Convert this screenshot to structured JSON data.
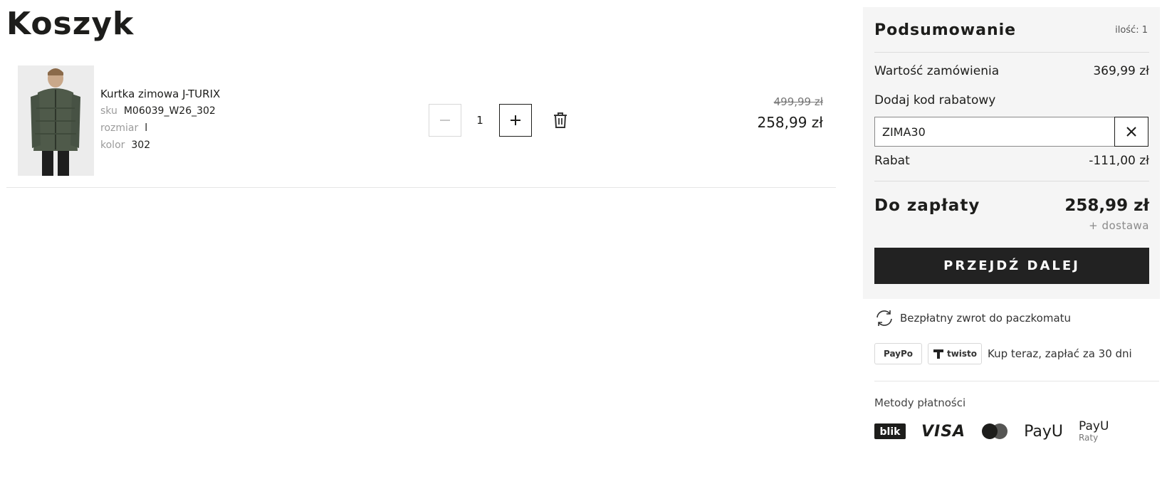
{
  "page": {
    "title": "Koszyk"
  },
  "cart": {
    "item": {
      "name": "Kurtka zimowa J-TURIX",
      "sku_label": "sku",
      "sku": "M06039_W26_302",
      "size_label": "rozmiar",
      "size": "l",
      "color_label": "kolor",
      "color": "302",
      "quantity": "1",
      "old_price": "499,99 zł",
      "price": "258,99 zł"
    }
  },
  "summary": {
    "title": "Podsumowanie",
    "count": "ilość: 1",
    "order_value_label": "Wartość zamówienia",
    "order_value": "369,99 zł",
    "coupon_label": "Dodaj kod rabatowy",
    "coupon_value": "ZIMA30",
    "discount_label": "Rabat",
    "discount": "-111,00 zł",
    "total_label": "Do zapłaty",
    "total": "258,99 zł",
    "delivery_note": "+ dostawa",
    "checkout_label": "PRZEJDŹ DALEJ"
  },
  "info": {
    "free_return": "Bezpłatny zwrot do paczkomatu",
    "paypo_badge": "PayPo",
    "twisto_badge": "twisto",
    "pay_later": "Kup teraz, zapłać za 30 dni",
    "payment_methods_label": "Metody płatności",
    "payment_methods": {
      "blik": "blik",
      "visa": "VISA",
      "payu": "PayU",
      "payu_raty": "PayU",
      "payu_raty_sub": "Raty"
    }
  },
  "colors": {
    "accent": "#222222",
    "summary_bg": "#f5f5f5",
    "muted_text": "#9b9b9b"
  },
  "icons": [
    "minus-icon",
    "plus-icon",
    "trash-icon",
    "close-icon",
    "refresh-icon",
    "blik-logo",
    "visa-logo",
    "mastercard-logo",
    "payu-logo",
    "payu-raty-logo"
  ]
}
